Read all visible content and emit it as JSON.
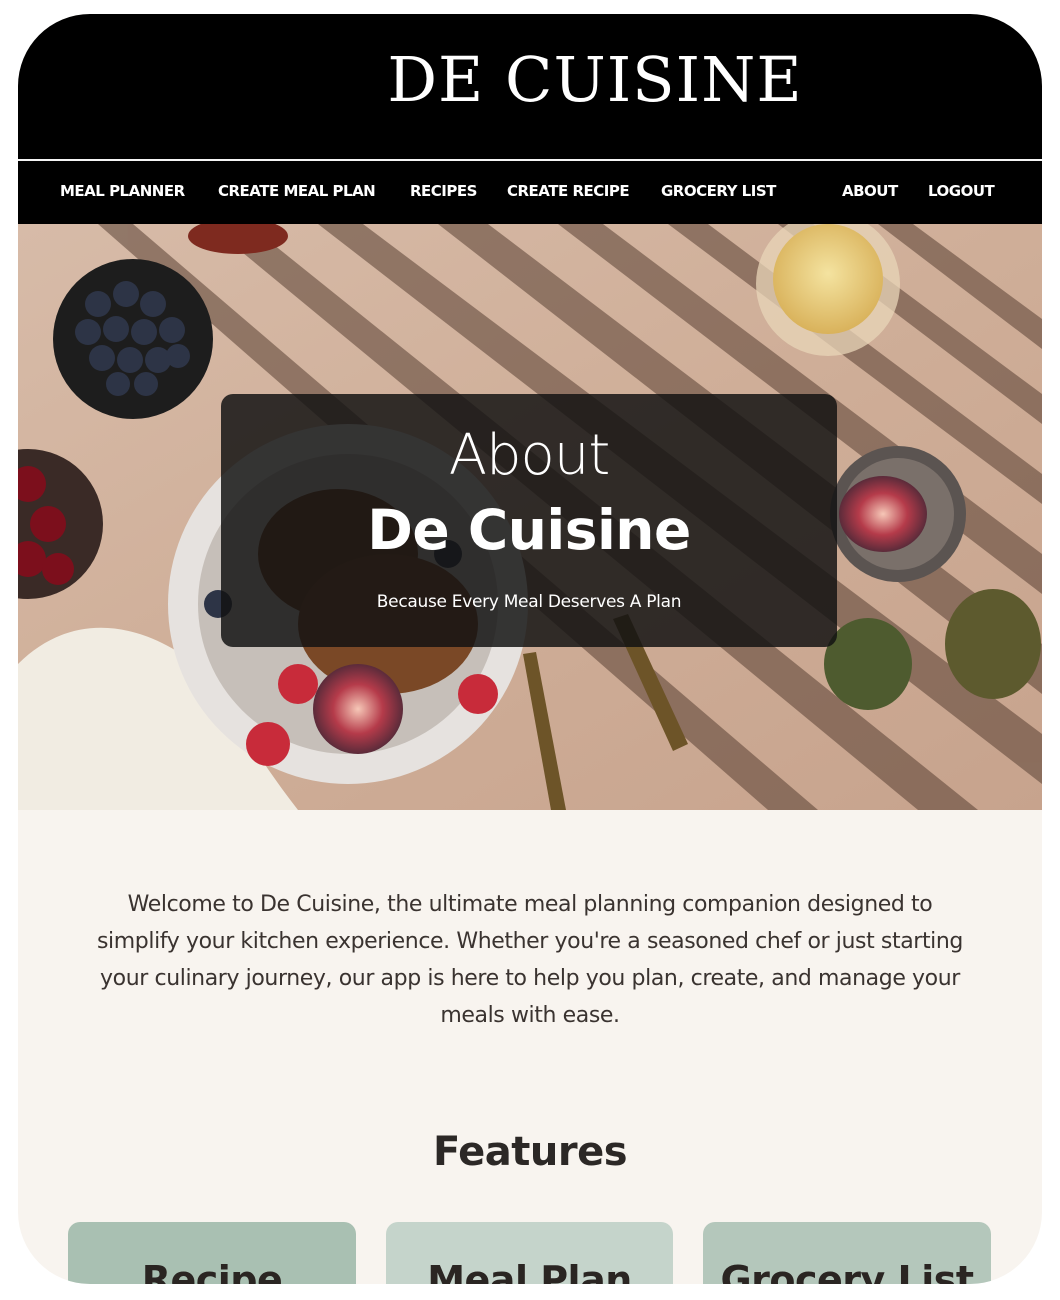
{
  "brand": {
    "title": "DE CUISINE"
  },
  "nav": {
    "items": [
      {
        "label": "MEAL PLANNER"
      },
      {
        "label": "CREATE MEAL PLAN"
      },
      {
        "label": "RECIPES"
      },
      {
        "label": "CREATE RECIPE"
      },
      {
        "label": "GROCERY LIST"
      },
      {
        "label": "ABOUT"
      },
      {
        "label": "LOGOUT"
      }
    ]
  },
  "hero": {
    "about": "About",
    "title": "De Cuisine",
    "subtitle": "Because Every Meal Deserves A Plan"
  },
  "intro": {
    "text": "Welcome to De Cuisine, the ultimate meal planning companion designed to simplify your kitchen experience. Whether you're a seasoned chef or just starting your culinary journey, our app is here to help you plan, create, and manage your meals with ease."
  },
  "features": {
    "title": "Features",
    "cards": [
      {
        "label": "Recipe",
        "color": "#a9c0b2"
      },
      {
        "label": "Meal Plan",
        "color": "#c5d4cb"
      },
      {
        "label": "Grocery List",
        "color": "#b4c7bb"
      }
    ]
  },
  "colors": {
    "header_bg": "#000000",
    "page_bg": "#f8f4ef",
    "text": "#3a3330"
  }
}
